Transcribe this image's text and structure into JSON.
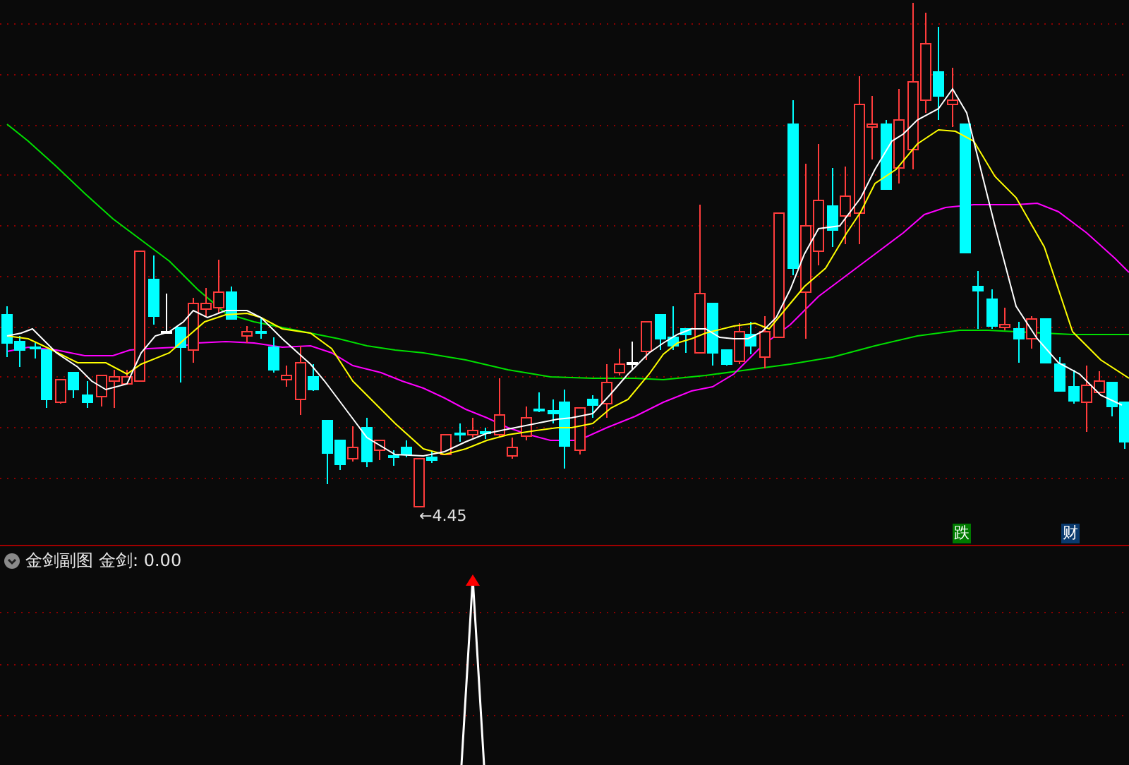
{
  "main_chart": {
    "low_marker": {
      "arrow": "←",
      "value": "4.45"
    },
    "event_badges": [
      {
        "text": "跌",
        "color": "#007a00"
      },
      {
        "text": "财",
        "color": "#0a3a6e"
      }
    ]
  },
  "sub_chart": {
    "title": "金剑副图",
    "reading": "金剑: 0.00"
  }
}
